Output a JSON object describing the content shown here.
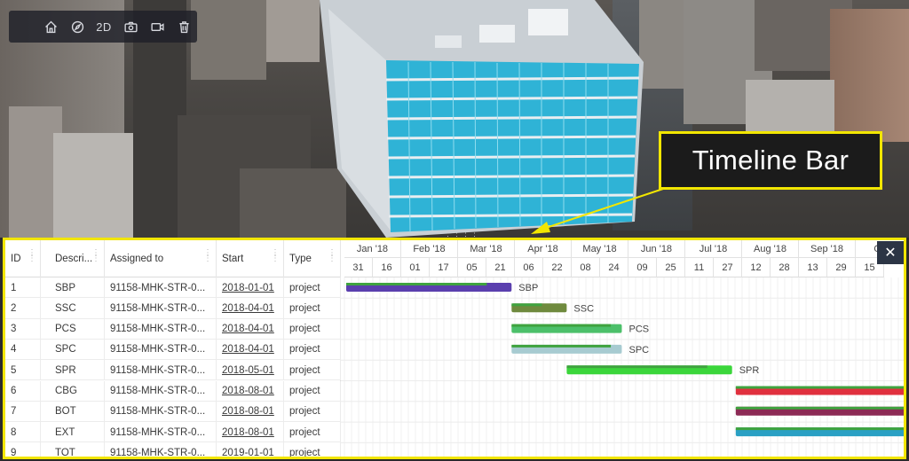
{
  "toolbar": {
    "buttons": [
      {
        "name": "home-button",
        "icon": "home-icon"
      },
      {
        "name": "compass-button",
        "icon": "compass-icon"
      },
      {
        "name": "view-2d-button",
        "label": "2D"
      },
      {
        "name": "camera-button",
        "icon": "camera-icon"
      },
      {
        "name": "video-button",
        "icon": "video-icon"
      },
      {
        "name": "delete-button",
        "icon": "trash-icon"
      }
    ]
  },
  "annotation": {
    "label": "Timeline Bar",
    "color": "#f2e600"
  },
  "timeline": {
    "columns": [
      "ID",
      "Descri...",
      "Assigned to",
      "Start",
      "Type"
    ],
    "months": [
      "Jan '18",
      "Feb '18",
      "Mar '18",
      "Apr '18",
      "May '18",
      "Jun '18",
      "Jul '18",
      "Aug '18",
      "Sep '18",
      "Oct '"
    ],
    "days": [
      "31",
      "16",
      "01",
      "17",
      "05",
      "21",
      "06",
      "22",
      "08",
      "24",
      "09",
      "25",
      "11",
      "27",
      "12",
      "28",
      "13",
      "29",
      "15"
    ],
    "rows": [
      {
        "id": "1",
        "desc": "SBP",
        "assigned": "91158-MHK-STR-0...",
        "start": "2018-01-01",
        "type": "project",
        "bar_label": "SBP",
        "color": "#5a3fae",
        "progress": 0.85
      },
      {
        "id": "2",
        "desc": "SSC",
        "assigned": "91158-MHK-STR-0...",
        "start": "2018-04-01",
        "type": "project",
        "bar_label": "SSC",
        "color": "#6f8a3e",
        "progress": 0.55
      },
      {
        "id": "3",
        "desc": "PCS",
        "assigned": "91158-MHK-STR-0...",
        "start": "2018-04-01",
        "type": "project",
        "bar_label": "PCS",
        "color": "#4cc06a",
        "progress": 0.9
      },
      {
        "id": "4",
        "desc": "SPC",
        "assigned": "91158-MHK-STR-0...",
        "start": "2018-04-01",
        "type": "project",
        "bar_label": "SPC",
        "color": "#a7cbd1",
        "progress": 0.9
      },
      {
        "id": "5",
        "desc": "SPR",
        "assigned": "91158-MHK-STR-0...",
        "start": "2018-05-01",
        "type": "project",
        "bar_label": "SPR",
        "color": "#3bd63b",
        "progress": 0.85
      },
      {
        "id": "6",
        "desc": "CBG",
        "assigned": "91158-MHK-STR-0...",
        "start": "2018-08-01",
        "type": "project",
        "bar_label": "",
        "color": "#e0303e",
        "progress": 1.0
      },
      {
        "id": "7",
        "desc": "BOT",
        "assigned": "91158-MHK-STR-0...",
        "start": "2018-08-01",
        "type": "project",
        "bar_label": "",
        "color": "#8c2a55",
        "progress": 0.85
      },
      {
        "id": "8",
        "desc": "EXT",
        "assigned": "91158-MHK-STR-0...",
        "start": "2018-08-01",
        "type": "project",
        "bar_label": "",
        "color": "#2aa0c4",
        "progress": 1.0
      },
      {
        "id": "9",
        "desc": "TOT",
        "assigned": "91158-MHK-STR-0...",
        "start": "2019-01-01",
        "type": "project",
        "bar_label": "",
        "color": "#3a8a3a",
        "progress": 0.0
      }
    ],
    "close_icon": "close-icon"
  }
}
